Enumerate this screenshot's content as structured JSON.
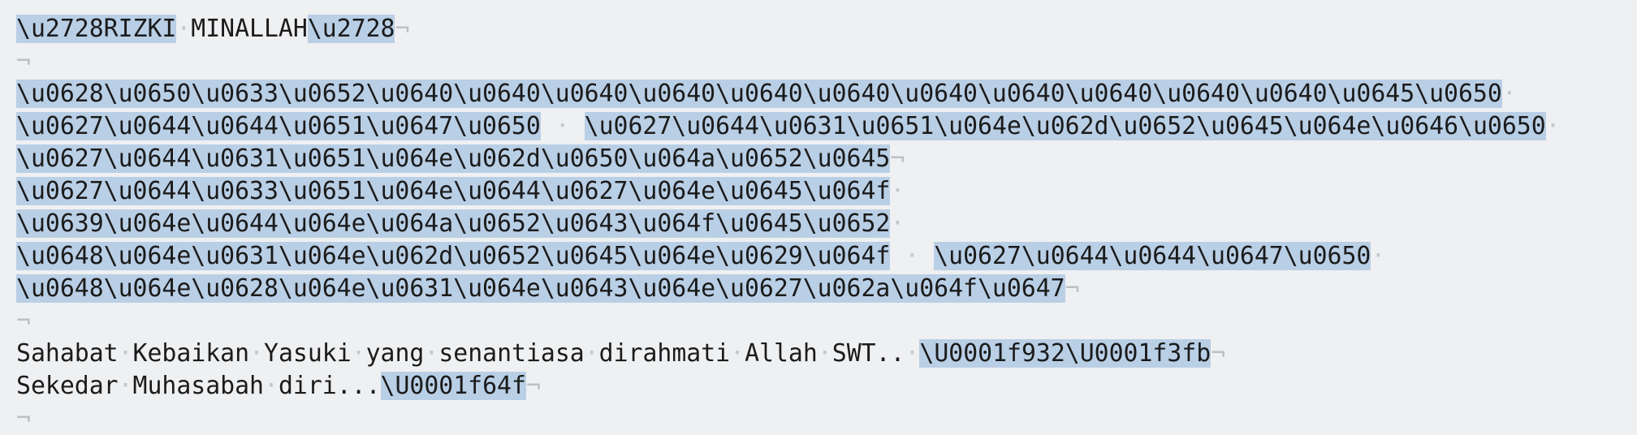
{
  "editor": {
    "colors": {
      "background": "#eff0f2",
      "text": "#1b1b1b",
      "selection": "#b9cfe6",
      "invisibles": "#c5c7ca"
    },
    "invisibles": {
      "space_marker": "·",
      "eol_marker": "¬"
    },
    "lines": [
      [
        {
          "t": "\\u2728RIZKI",
          "hl": true
        },
        {
          "t": "·",
          "ws": true
        },
        {
          "t": "MINALLAH"
        },
        {
          "t": "\\u2728",
          "hl": true
        },
        {
          "t": "¬",
          "eol": true
        }
      ],
      [
        {
          "t": "¬",
          "eol": true
        }
      ],
      [
        {
          "t": "\\u0628\\u0650\\u0633\\u0652\\u0640\\u0640\\u0640\\u0640\\u0640\\u0640\\u0640\\u0640\\u0640\\u0640\\u0640\\u0645\\u0650",
          "hl": true
        },
        {
          "t": "·",
          "ws": true
        }
      ],
      [
        {
          "t": "\\u0627\\u0644\\u0644\\u0651\\u0647\\u0650",
          "hl": true
        },
        {
          "t": " · ",
          "ws": true
        },
        {
          "t": "\\u0627\\u0644\\u0631\\u0651\\u064e\\u062d\\u0652\\u0645\\u064e\\u0646\\u0650",
          "hl": true
        },
        {
          "t": "·",
          "ws": true
        }
      ],
      [
        {
          "t": "\\u0627\\u0644\\u0631\\u0651\\u064e\\u062d\\u0650\\u064a\\u0652\\u0645",
          "hl": true
        },
        {
          "t": "¬",
          "eol": true
        }
      ],
      [
        {
          "t": "\\u0627\\u0644\\u0633\\u0651\\u064e\\u0644\\u0627\\u064e\\u0645\\u064f",
          "hl": true
        },
        {
          "t": "·",
          "ws": true
        }
      ],
      [
        {
          "t": "\\u0639\\u064e\\u0644\\u064e\\u064a\\u0652\\u0643\\u064f\\u0645\\u0652",
          "hl": true
        },
        {
          "t": "·",
          "ws": true
        }
      ],
      [
        {
          "t": "\\u0648\\u064e\\u0631\\u064e\\u062d\\u0652\\u0645\\u064e\\u0629\\u064f",
          "hl": true
        },
        {
          "t": " · ",
          "ws": true
        },
        {
          "t": "\\u0627\\u0644\\u0644\\u0647\\u0650",
          "hl": true
        },
        {
          "t": "·",
          "ws": true
        }
      ],
      [
        {
          "t": "\\u0648\\u064e\\u0628\\u064e\\u0631\\u064e\\u0643\\u064e\\u0627\\u062a\\u064f\\u0647",
          "hl": true
        },
        {
          "t": "¬",
          "eol": true
        }
      ],
      [
        {
          "t": "¬",
          "eol": true
        }
      ],
      [
        {
          "t": "Sahabat"
        },
        {
          "t": "·",
          "ws": true
        },
        {
          "t": "Kebaikan"
        },
        {
          "t": "·",
          "ws": true
        },
        {
          "t": "Yasuki"
        },
        {
          "t": "·",
          "ws": true
        },
        {
          "t": "yang"
        },
        {
          "t": "·",
          "ws": true
        },
        {
          "t": "senantiasa"
        },
        {
          "t": "·",
          "ws": true
        },
        {
          "t": "dirahmati"
        },
        {
          "t": "·",
          "ws": true
        },
        {
          "t": "Allah"
        },
        {
          "t": "·",
          "ws": true
        },
        {
          "t": "SWT.."
        },
        {
          "t": "·",
          "ws": true
        },
        {
          "t": "\\U0001f932\\U0001f3fb",
          "hl": true
        },
        {
          "t": "¬",
          "eol": true
        }
      ],
      [
        {
          "t": "Sekedar"
        },
        {
          "t": "·",
          "ws": true
        },
        {
          "t": "Muhasabah"
        },
        {
          "t": "·",
          "ws": true
        },
        {
          "t": "diri..."
        },
        {
          "t": "\\U0001f64f",
          "hl": true
        },
        {
          "t": "¬",
          "eol": true
        }
      ],
      [
        {
          "t": "¬",
          "eol": true
        }
      ]
    ]
  }
}
